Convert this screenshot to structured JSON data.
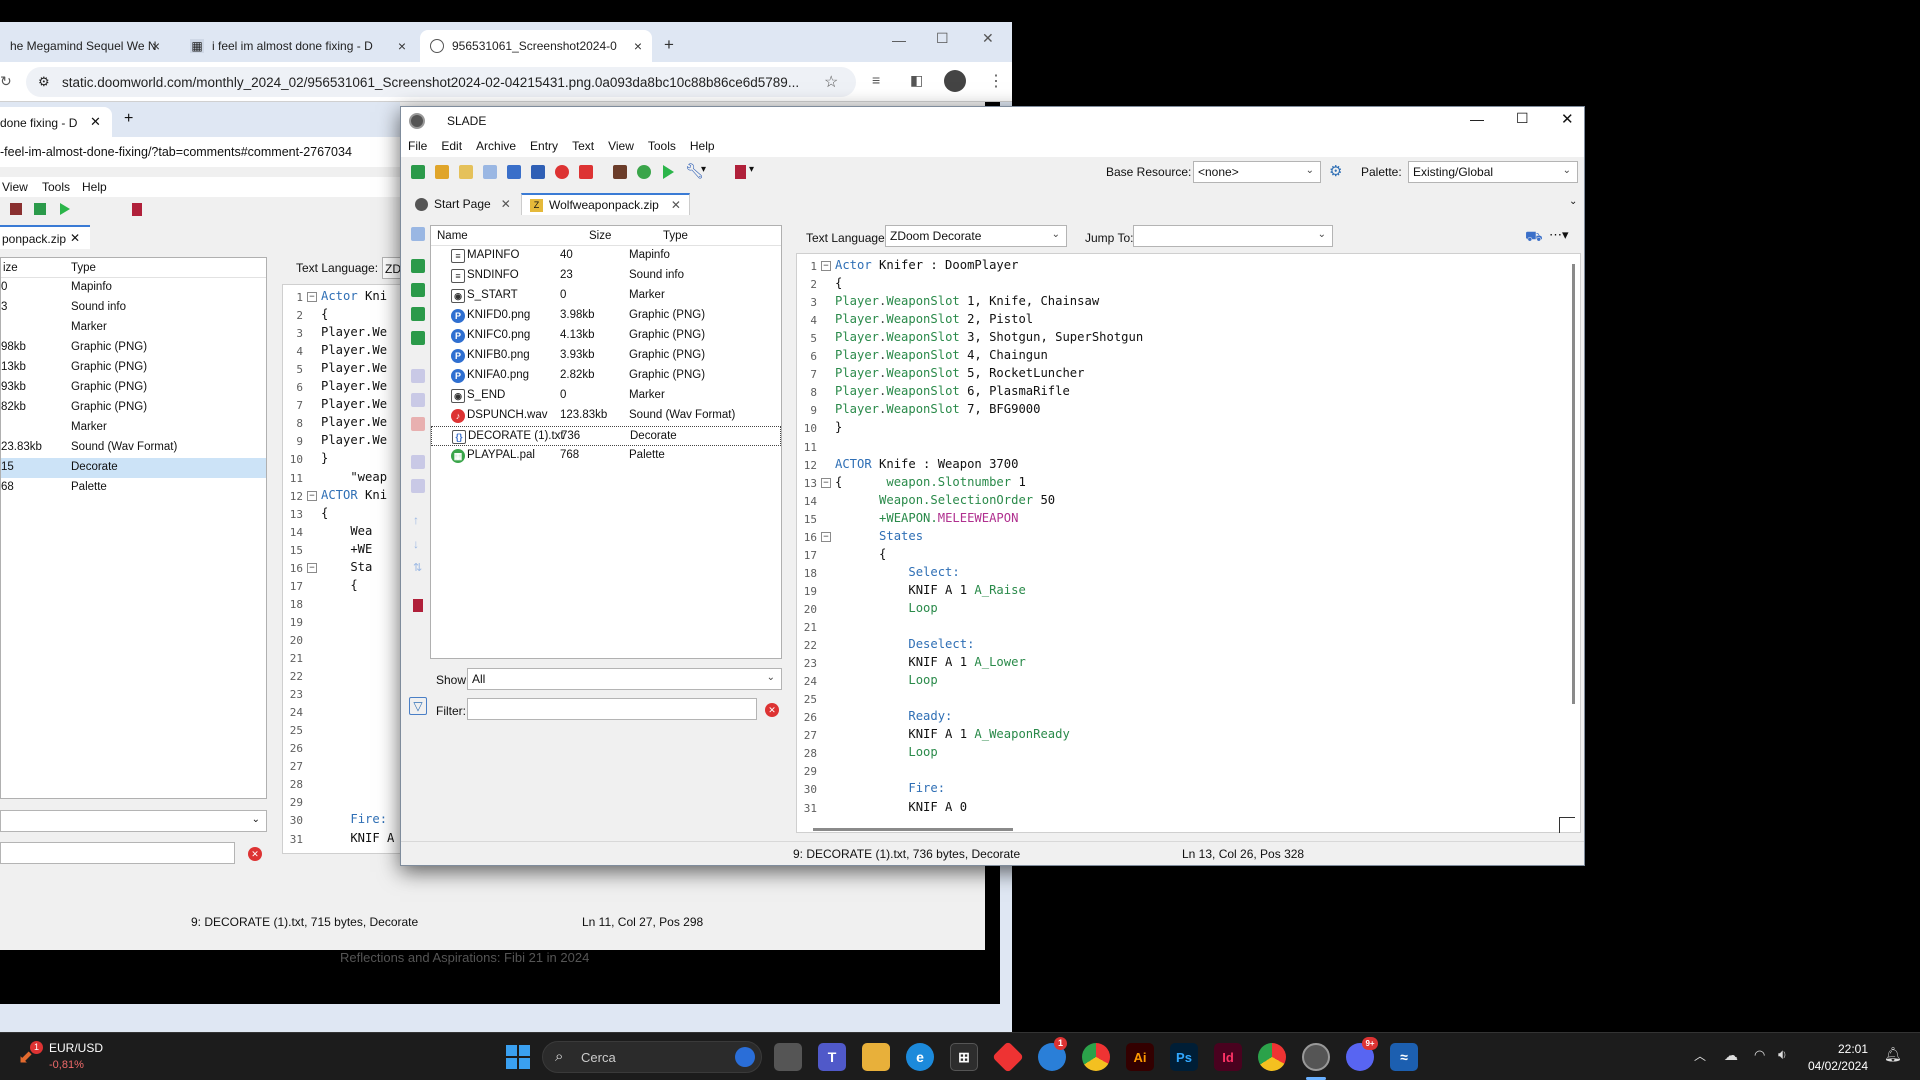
{
  "browser": {
    "tabs": [
      {
        "title": "he Megamind Sequel We N",
        "close": "×"
      },
      {
        "title": "i feel im almost done fixing - D",
        "close": "×"
      },
      {
        "title": "956531061_Screenshot2024-0",
        "close": "×"
      }
    ],
    "new_tab": "+",
    "url": "static.doomworld.com/monthly_2024_02/956531061_Screenshot2024-02-04215431.png.0a093da8bc10c88b86ce6d5789..."
  },
  "inner": {
    "tab_title": "done fixing - D",
    "url_fragment": "-feel-im-almost-done-fixing/?tab=comments#comment-2767034",
    "menu": [
      "View",
      "Tools",
      "Help"
    ],
    "doc_tab": "ponpack.zip",
    "list_header": {
      "size": "ize",
      "type": "Type"
    },
    "rows": [
      {
        "size": "0",
        "type": "Mapinfo"
      },
      {
        "size": "3",
        "type": "Sound info"
      },
      {
        "size": "",
        "type": "Marker"
      },
      {
        "size": "98kb",
        "type": "Graphic (PNG)"
      },
      {
        "size": "13kb",
        "type": "Graphic (PNG)"
      },
      {
        "size": "93kb",
        "type": "Graphic (PNG)"
      },
      {
        "size": "82kb",
        "type": "Graphic (PNG)"
      },
      {
        "size": "",
        "type": "Marker"
      },
      {
        "size": "23.83kb",
        "type": "Sound (Wav Format)"
      },
      {
        "size": "15",
        "type": "Decorate"
      },
      {
        "size": "68",
        "type": "Palette"
      }
    ],
    "text_language_label": "Text Language:",
    "text_language_value": "ZD",
    "code": [
      "Actor Kni",
      "{",
      "Player.We",
      "Player.We",
      "Player.We",
      "Player.We",
      "Player.We",
      "Player.We",
      "Player.We",
      "}",
      "    \"weap",
      "ACTOR Kni",
      "{",
      "    Wea",
      "    +WE",
      "    Sta",
      "    {",
      "",
      "",
      "",
      "",
      "",
      "",
      "",
      "",
      "",
      "",
      "",
      "",
      "    Fire:",
      "    KNIF A 0"
    ],
    "status_left": "9: DECORATE (1).txt, 715 bytes, Decorate",
    "status_right": "Ln 11, Col 27, Pos 298",
    "footer_text": "Reflections and Aspirations: Fibi 21 in 2024"
  },
  "slade": {
    "title": "SLADE",
    "menu": [
      "File",
      "Edit",
      "Archive",
      "Entry",
      "Text",
      "View",
      "Tools",
      "Help"
    ],
    "base_resource_label": "Base Resource:",
    "base_resource_value": "<none>",
    "palette_label": "Palette:",
    "palette_value": "Existing/Global",
    "tabs": [
      {
        "label": "Start Page"
      },
      {
        "label": "Wolfweaponpack.zip"
      }
    ],
    "list_header": {
      "name": "Name",
      "size": "Size",
      "type": "Type"
    },
    "entries": [
      {
        "name": "MAPINFO",
        "size": "40",
        "type": "Mapinfo",
        "icon": "text-icon"
      },
      {
        "name": "SNDINFO",
        "size": "23",
        "type": "Sound info",
        "icon": "text-icon"
      },
      {
        "name": "S_START",
        "size": "0",
        "type": "Marker",
        "icon": "marker-icon"
      },
      {
        "name": "KNIFD0.png",
        "size": "3.98kb",
        "type": "Graphic (PNG)",
        "icon": "png-icon"
      },
      {
        "name": "KNIFC0.png",
        "size": "4.13kb",
        "type": "Graphic (PNG)",
        "icon": "png-icon"
      },
      {
        "name": "KNIFB0.png",
        "size": "3.93kb",
        "type": "Graphic (PNG)",
        "icon": "png-icon"
      },
      {
        "name": "KNIFA0.png",
        "size": "2.82kb",
        "type": "Graphic (PNG)",
        "icon": "png-icon"
      },
      {
        "name": "S_END",
        "size": "0",
        "type": "Marker",
        "icon": "marker-icon"
      },
      {
        "name": "DSPUNCH.wav",
        "size": "123.83kb",
        "type": "Sound (Wav Format)",
        "icon": "sound-icon"
      },
      {
        "name": "DECORATE (1).txt",
        "size": "736",
        "type": "Decorate",
        "icon": "decorate-icon"
      },
      {
        "name": "PLAYPAL.pal",
        "size": "768",
        "type": "Palette",
        "icon": "palette-icon"
      }
    ],
    "show_label": "Show:",
    "show_value": "All",
    "filter_label": "Filter:",
    "filter_value": "",
    "text_language_label": "Text Language:",
    "text_language_value": "ZDoom Decorate",
    "jump_to_label": "Jump To:",
    "jump_to_value": "",
    "status_left": "9: DECORATE (1).txt, 736 bytes, Decorate",
    "status_right": "Ln 13, Col 26, Pos 328"
  },
  "taskbar": {
    "ticker_symbol": "EUR/USD",
    "ticker_change": "-0,81%",
    "ticker_badge": "1",
    "search_placeholder": "Cerca",
    "time": "22:01",
    "date": "04/02/2024",
    "discord_badge": "9+",
    "badge_one": "1"
  }
}
